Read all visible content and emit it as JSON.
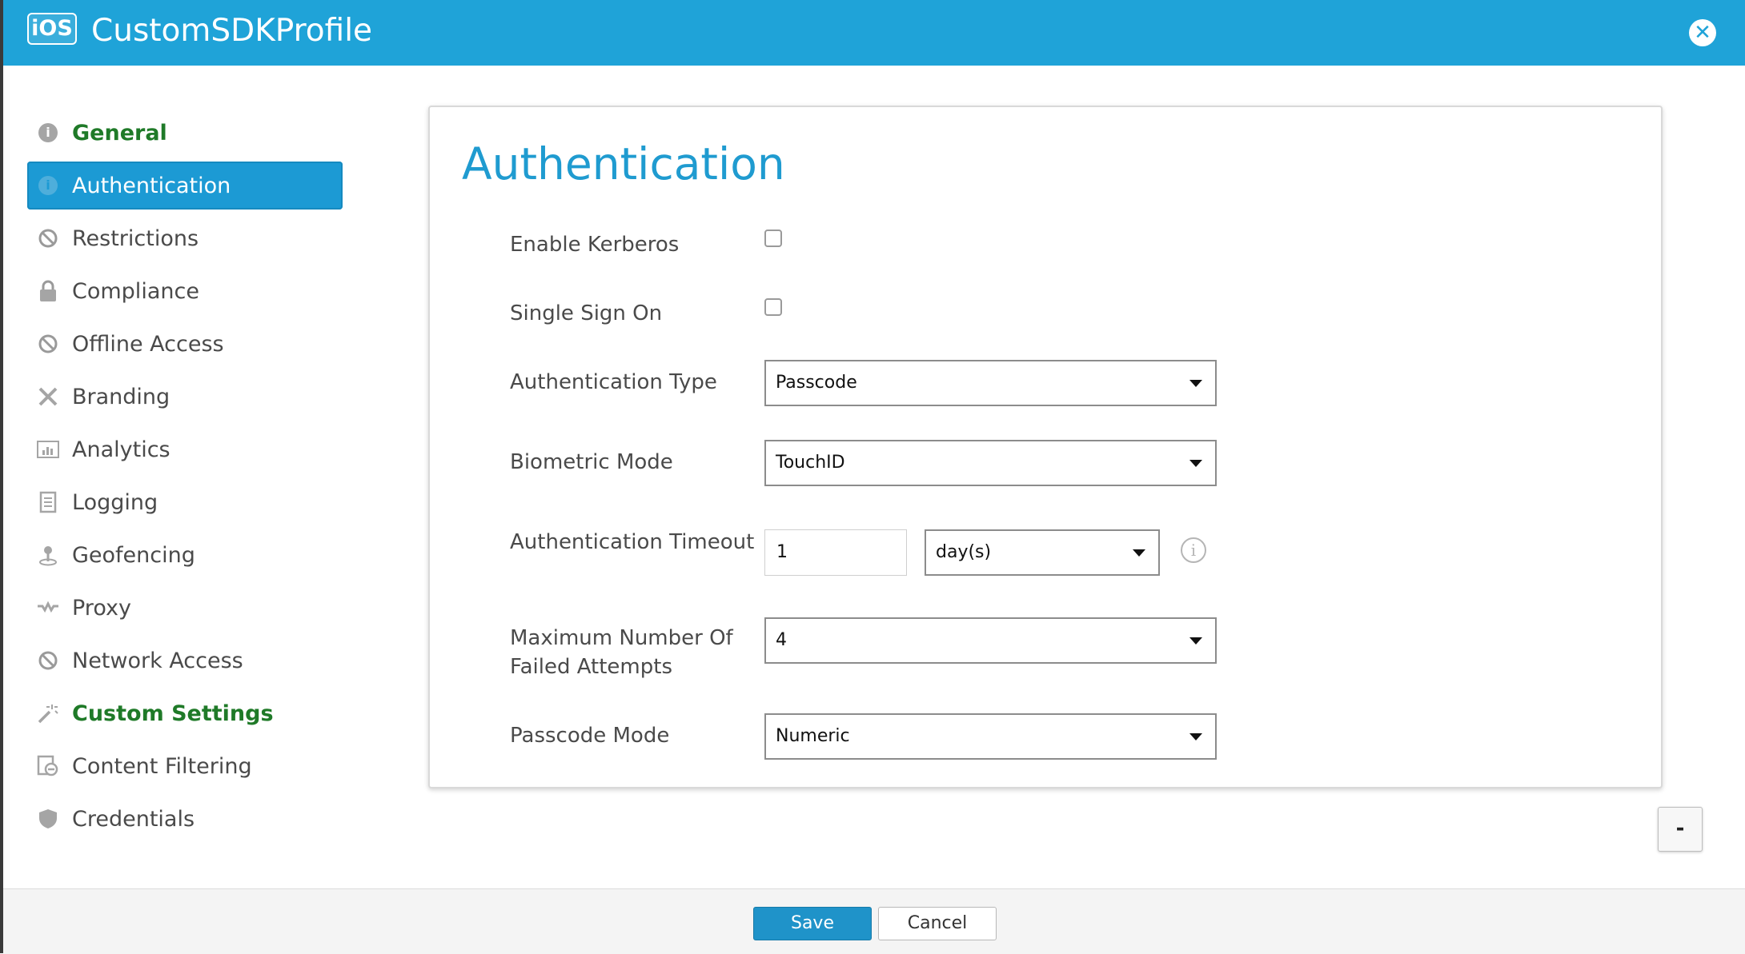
{
  "header": {
    "badge": "iOS",
    "title": "CustomSDKProfile"
  },
  "sidebar": {
    "items": [
      {
        "label": "General",
        "icon": "info-icon",
        "state": "configured"
      },
      {
        "label": "Authentication",
        "icon": "info-icon",
        "state": "active"
      },
      {
        "label": "Restrictions",
        "icon": "no-entry-icon",
        "state": "normal"
      },
      {
        "label": "Compliance",
        "icon": "lock-icon",
        "state": "normal"
      },
      {
        "label": "Offline Access",
        "icon": "no-entry-icon",
        "state": "normal"
      },
      {
        "label": "Branding",
        "icon": "brush-icon",
        "state": "normal"
      },
      {
        "label": "Analytics",
        "icon": "chart-icon",
        "state": "normal"
      },
      {
        "label": "Logging",
        "icon": "document-icon",
        "state": "normal"
      },
      {
        "label": "Geofencing",
        "icon": "location-pin-icon",
        "state": "normal"
      },
      {
        "label": "Proxy",
        "icon": "wave-icon",
        "state": "normal"
      },
      {
        "label": "Network Access",
        "icon": "no-entry-icon",
        "state": "normal"
      },
      {
        "label": "Custom Settings",
        "icon": "magic-wand-icon",
        "state": "configured"
      },
      {
        "label": "Content Filtering",
        "icon": "filter-document-icon",
        "state": "normal"
      },
      {
        "label": "Credentials",
        "icon": "shield-icon",
        "state": "normal"
      }
    ]
  },
  "panel": {
    "title": "Authentication",
    "fields": {
      "enable_kerberos": {
        "label": "Enable Kerberos",
        "checked": false
      },
      "single_sign_on": {
        "label": "Single Sign On",
        "checked": false
      },
      "authentication_type": {
        "label": "Authentication Type",
        "value": "Passcode"
      },
      "biometric_mode": {
        "label": "Biometric Mode",
        "value": "TouchID"
      },
      "authentication_timeout": {
        "label": "Authentication Timeout",
        "value": "1",
        "unit": "day(s)"
      },
      "max_failed_attempts": {
        "label_line1": "Maximum Number Of",
        "label_line2": "Failed Attempts",
        "value": "4"
      },
      "passcode_mode": {
        "label": "Passcode Mode",
        "value": "Numeric"
      }
    }
  },
  "collapse_button": "-",
  "footer": {
    "save_label": "Save",
    "cancel_label": "Cancel"
  },
  "colors": {
    "header_bg": "#1fa3d8",
    "active_item_bg": "#1c9ad4",
    "configured_text": "#1f7a28",
    "title_text": "#1f9bd0",
    "save_bg": "#1f93c9"
  }
}
